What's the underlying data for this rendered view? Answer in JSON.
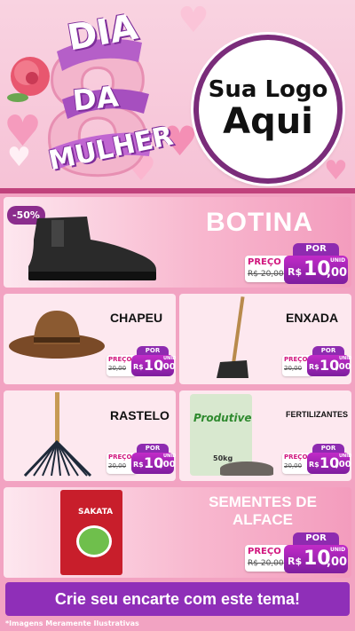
{
  "header": {
    "title_line1": "DIA",
    "title_number": "8",
    "title_line2": "DA",
    "title_line3": "MULHER",
    "logo_line1": "Sua Logo",
    "logo_line2": "Aqui"
  },
  "price_labels": {
    "por": "POR",
    "preco": "PREÇO",
    "unid": "UNID"
  },
  "products": [
    {
      "name": "BOTINA",
      "discount": "-50%",
      "old_price": "R$ 20,00",
      "currency": "R$",
      "price_int": "10",
      "price_dec": ",00",
      "icon": "boot-icon"
    },
    {
      "name": "CHAPEU",
      "old_price": "20,00",
      "currency": "R$",
      "price_int": "10",
      "price_dec": ",00",
      "icon": "hat-icon"
    },
    {
      "name": "ENXADA",
      "old_price": "20,00",
      "currency": "R$",
      "price_int": "10",
      "price_dec": ",00",
      "icon": "hoe-icon"
    },
    {
      "name": "RASTELO",
      "old_price": "20,00",
      "currency": "R$",
      "price_int": "10",
      "price_dec": ",00",
      "icon": "rake-icon"
    },
    {
      "name": "FERTILIZANTES",
      "old_price": "20,00",
      "currency": "R$",
      "price_int": "10",
      "price_dec": ",00",
      "icon": "fertilizer-bag-icon",
      "bag_brand": "Produtive",
      "bag_weight": "50kg"
    },
    {
      "name_line1": "SEMENTES DE",
      "name_line2": "ALFACE",
      "old_price": "R$ 20,00",
      "currency": "R$",
      "price_int": "10",
      "price_dec": ",00",
      "icon": "seed-packet-icon",
      "packet_brand": "SAKATA"
    }
  ],
  "footer": {
    "cta": "Crie seu encarte com este tema!",
    "disclaimer": "*Imagens Meramente Ilustrativas"
  },
  "colors": {
    "accent_purple": "#8f2fb8",
    "pink_bg": "#f2a3c2",
    "card_pink": "#fde8ef",
    "price_magenta": "#d1167e"
  }
}
